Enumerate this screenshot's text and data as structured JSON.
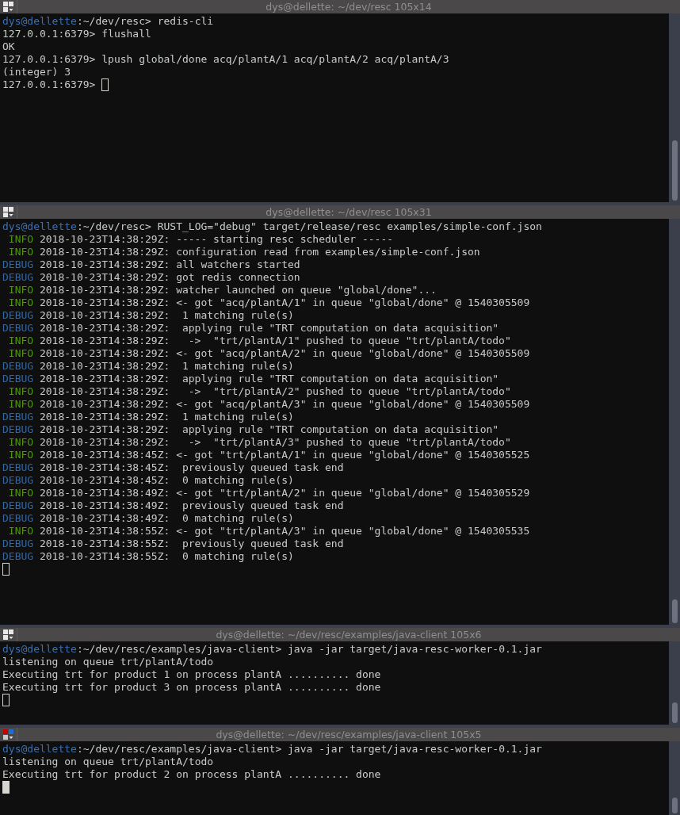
{
  "panes": [
    {
      "title": "dys@dellette: ~/dev/resc 105x14",
      "active": false,
      "lines": [
        {
          "kind": "prompt",
          "user": "dys@dellette",
          "path": ":~/dev/resc> ",
          "command": "redis-cli"
        },
        {
          "kind": "output",
          "text": "127.0.0.1:6379> flushall"
        },
        {
          "kind": "output",
          "text": "OK"
        },
        {
          "kind": "output",
          "text": "127.0.0.1:6379> lpush global/done acq/plantA/1 acq/plantA/2 acq/plantA/3"
        },
        {
          "kind": "output",
          "text": "(integer) 3"
        },
        {
          "kind": "input",
          "text": "127.0.0.1:6379> "
        }
      ]
    },
    {
      "title": "dys@dellette: ~/dev/resc 105x31",
      "active": false,
      "lines": [
        {
          "kind": "prompt",
          "user": "dys@dellette",
          "path": ":~/dev/resc> ",
          "command": "RUST_LOG=\"debug\" target/release/resc examples/simple-conf.json"
        },
        {
          "kind": "info_log",
          "level": "INFO",
          "text": "2018-10-23T14:38:29Z: ----- starting resc scheduler -----"
        },
        {
          "kind": "info_log",
          "level": "INFO",
          "text": "2018-10-23T14:38:29Z: configuration read from examples/simple-conf.json"
        },
        {
          "kind": "debug_log",
          "level": "DEBUG",
          "text": "2018-10-23T14:38:29Z: all watchers started"
        },
        {
          "kind": "debug_log",
          "level": "DEBUG",
          "text": "2018-10-23T14:38:29Z: got redis connection"
        },
        {
          "kind": "info_log",
          "level": "INFO",
          "text": "2018-10-23T14:38:29Z: watcher launched on queue \"global/done\"..."
        },
        {
          "kind": "info_log",
          "level": "INFO",
          "text": "2018-10-23T14:38:29Z: <- got \"acq/plantA/1\" in queue \"global/done\" @ 1540305509"
        },
        {
          "kind": "debug_log",
          "level": "DEBUG",
          "text": "2018-10-23T14:38:29Z:  1 matching rule(s)"
        },
        {
          "kind": "debug_log",
          "level": "DEBUG",
          "text": "2018-10-23T14:38:29Z:  applying rule \"TRT computation on data acquisition\""
        },
        {
          "kind": "info_log",
          "level": "INFO",
          "text": "2018-10-23T14:38:29Z:   ->  \"trt/plantA/1\" pushed to queue \"trt/plantA/todo\""
        },
        {
          "kind": "info_log",
          "level": "INFO",
          "text": "2018-10-23T14:38:29Z: <- got \"acq/plantA/2\" in queue \"global/done\" @ 1540305509"
        },
        {
          "kind": "debug_log",
          "level": "DEBUG",
          "text": "2018-10-23T14:38:29Z:  1 matching rule(s)"
        },
        {
          "kind": "debug_log",
          "level": "DEBUG",
          "text": "2018-10-23T14:38:29Z:  applying rule \"TRT computation on data acquisition\""
        },
        {
          "kind": "info_log",
          "level": "INFO",
          "text": "2018-10-23T14:38:29Z:   ->  \"trt/plantA/2\" pushed to queue \"trt/plantA/todo\""
        },
        {
          "kind": "info_log",
          "level": "INFO",
          "text": "2018-10-23T14:38:29Z: <- got \"acq/plantA/3\" in queue \"global/done\" @ 1540305509"
        },
        {
          "kind": "debug_log",
          "level": "DEBUG",
          "text": "2018-10-23T14:38:29Z:  1 matching rule(s)"
        },
        {
          "kind": "debug_log",
          "level": "DEBUG",
          "text": "2018-10-23T14:38:29Z:  applying rule \"TRT computation on data acquisition\""
        },
        {
          "kind": "info_log",
          "level": "INFO",
          "text": "2018-10-23T14:38:29Z:   ->  \"trt/plantA/3\" pushed to queue \"trt/plantA/todo\""
        },
        {
          "kind": "info_log",
          "level": "INFO",
          "text": "2018-10-23T14:38:45Z: <- got \"trt/plantA/1\" in queue \"global/done\" @ 1540305525"
        },
        {
          "kind": "debug_log",
          "level": "DEBUG",
          "text": "2018-10-23T14:38:45Z:  previously queued task end"
        },
        {
          "kind": "debug_log",
          "level": "DEBUG",
          "text": "2018-10-23T14:38:45Z:  0 matching rule(s)"
        },
        {
          "kind": "info_log",
          "level": "INFO",
          "text": "2018-10-23T14:38:49Z: <- got \"trt/plantA/2\" in queue \"global/done\" @ 1540305529"
        },
        {
          "kind": "debug_log",
          "level": "DEBUG",
          "text": "2018-10-23T14:38:49Z:  previously queued task end"
        },
        {
          "kind": "debug_log",
          "level": "DEBUG",
          "text": "2018-10-23T14:38:49Z:  0 matching rule(s)"
        },
        {
          "kind": "info_log",
          "level": "INFO",
          "text": "2018-10-23T14:38:55Z: <- got \"trt/plantA/3\" in queue \"global/done\" @ 1540305535"
        },
        {
          "kind": "debug_log",
          "level": "DEBUG",
          "text": "2018-10-23T14:38:55Z:  previously queued task end"
        },
        {
          "kind": "debug_log",
          "level": "DEBUG",
          "text": "2018-10-23T14:38:55Z:  0 matching rule(s)"
        },
        {
          "kind": "cursor"
        }
      ]
    },
    {
      "title": "dys@dellette: ~/dev/resc/examples/java-client 105x6",
      "active": false,
      "lines": [
        {
          "kind": "prompt",
          "user": "dys@dellette",
          "path": ":~/dev/resc/examples/java-client> ",
          "command": "java -jar target/java-resc-worker-0.1.jar"
        },
        {
          "kind": "output",
          "text": "listening on queue trt/plantA/todo"
        },
        {
          "kind": "output",
          "text": "Executing trt for product 1 on process plantA .......... done"
        },
        {
          "kind": "output",
          "text": "Executing trt for product 3 on process plantA .......... done"
        },
        {
          "kind": "cursor"
        }
      ]
    },
    {
      "title": "dys@dellette: ~/dev/resc/examples/java-client 105x5",
      "active": true,
      "lines": [
        {
          "kind": "prompt",
          "user": "dys@dellette",
          "path": ":~/dev/resc/examples/java-client> ",
          "command": "java -jar target/java-resc-worker-0.1.jar"
        },
        {
          "kind": "output",
          "text": "listening on queue trt/plantA/todo"
        },
        {
          "kind": "output",
          "text": "Executing trt for product 2 on process plantA .......... done"
        },
        {
          "kind": "cursor"
        }
      ]
    }
  ]
}
